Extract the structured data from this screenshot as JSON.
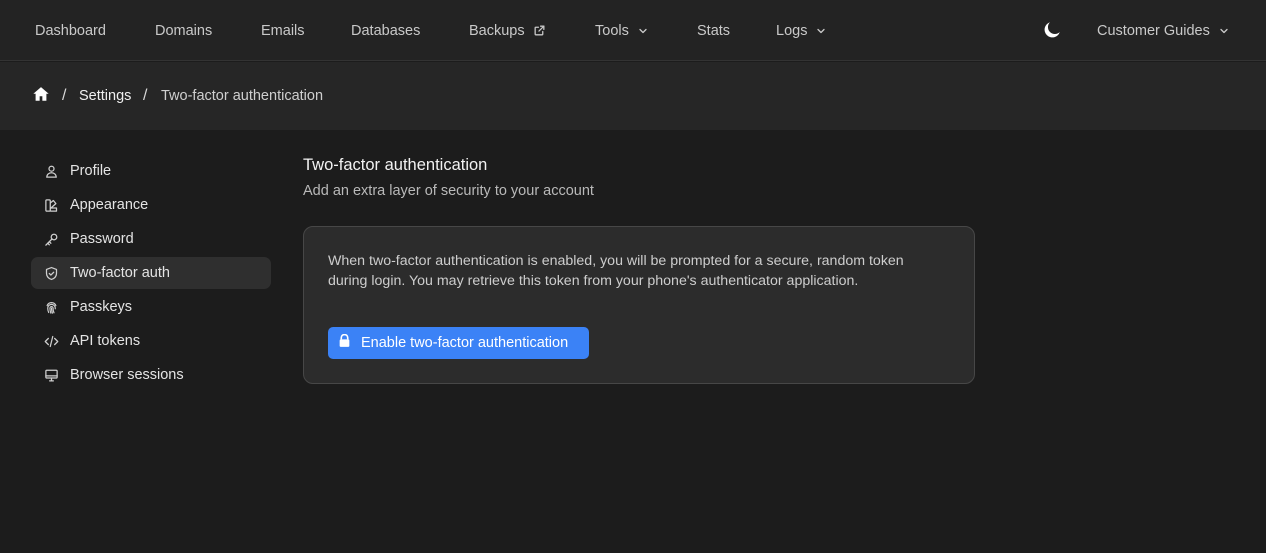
{
  "nav": {
    "dashboard": "Dashboard",
    "domains": "Domains",
    "emails": "Emails",
    "databases": "Databases",
    "backups": "Backups",
    "tools": "Tools",
    "stats": "Stats",
    "logs": "Logs",
    "account_menu": "Customer Guides",
    "icons": {
      "backups": "external-link-icon",
      "tools": "chevron-down-icon",
      "logs": "chevron-down-icon",
      "theme": "moon-icon"
    }
  },
  "breadcrumb": {
    "home_icon": "home-icon",
    "items": [
      "Settings",
      "Two-factor authentication"
    ],
    "separator": "/"
  },
  "sidebar": {
    "items": [
      {
        "label": "Profile",
        "icon": "user-icon"
      },
      {
        "label": "Appearance",
        "icon": "palette-icon"
      },
      {
        "label": "Password",
        "icon": "key-icon"
      },
      {
        "label": "Two-factor auth",
        "icon": "shield-check-icon",
        "active": true
      },
      {
        "label": "Passkeys",
        "icon": "fingerprint-icon"
      },
      {
        "label": "API tokens",
        "icon": "code-icon"
      },
      {
        "label": "Browser sessions",
        "icon": "monitor-icon"
      }
    ]
  },
  "main": {
    "title": "Two-factor authentication",
    "subtitle": "Add an extra layer of security to your account",
    "card": {
      "description": "When two-factor authentication is enabled, you will be prompted for a secure, random token during login. You may retrieve this token from your phone's authenticator application.",
      "button_label": "Enable two-factor authentication",
      "button_icon": "lock-icon"
    }
  },
  "colors": {
    "background": "#1c1c1c",
    "topbar": "#232323",
    "breadcrumb_bar": "#262626",
    "card": "#2c2c2c",
    "accent": "#3b82f6"
  }
}
